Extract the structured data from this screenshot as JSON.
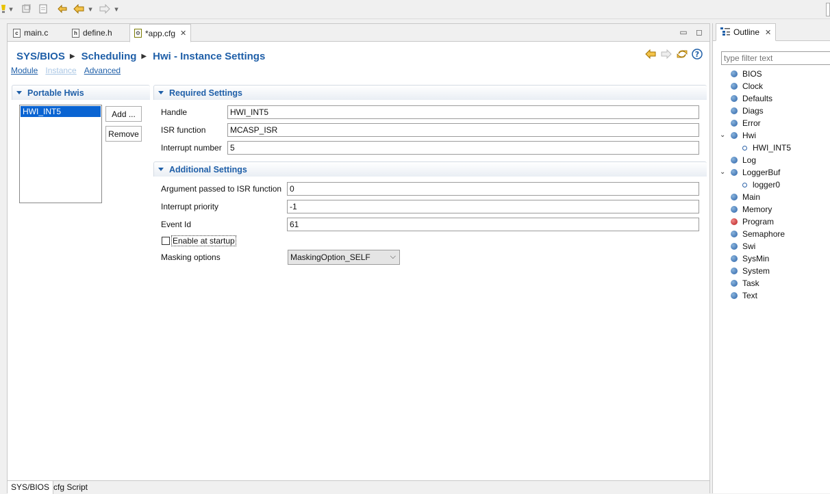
{
  "editor": {
    "tabs": [
      {
        "label": "main.c",
        "icon": "c-file-icon",
        "icon_text": "c"
      },
      {
        "label": "define.h",
        "icon": "h-file-icon",
        "icon_text": "h"
      },
      {
        "label": "*app.cfg",
        "icon": "cfg-file-icon",
        "icon_text": "⚙",
        "close": "✕"
      }
    ],
    "minimize": "▭",
    "maximize": "◻"
  },
  "breadcrumb": [
    "SYS/BIOS",
    "Scheduling",
    "Hwi - Instance Settings"
  ],
  "page_links": {
    "module": "Module",
    "instance": "Instance",
    "advanced": "Advanced"
  },
  "portable": {
    "title": "Portable Hwis",
    "items": [
      "HWI_INT5"
    ],
    "add": "Add ...",
    "remove": "Remove"
  },
  "required": {
    "title": "Required Settings",
    "handle_label": "Handle",
    "handle_value": "HWI_INT5",
    "isr_label": "ISR function",
    "isr_value": "MCASP_ISR",
    "intnum_label": "Interrupt number",
    "intnum_value": "5"
  },
  "additional": {
    "title": "Additional Settings",
    "arg_label": "Argument passed to ISR function",
    "arg_value": "0",
    "prio_label": "Interrupt priority",
    "prio_value": "-1",
    "event_label": "Event Id",
    "event_value": "61",
    "enable_label": "Enable at startup",
    "mask_label": "Masking options",
    "mask_value": "MaskingOption_SELF"
  },
  "bottom_tabs": [
    "SYS/BIOS",
    "cfg Script"
  ],
  "outline": {
    "title": "Outline",
    "close": "✕",
    "filter_placeholder": "type filter text",
    "items": [
      "BIOS",
      "Clock",
      "Defaults",
      "Diags",
      "Error",
      "Hwi",
      "HWI_INT5",
      "Log",
      "LoggerBuf",
      "logger0",
      "Main",
      "Memory",
      "Program",
      "Semaphore",
      "Swi",
      "SysMin",
      "System",
      "Task",
      "Text"
    ]
  },
  "colors": {
    "accent": "#1f5fa8",
    "selection": "#0a64d2",
    "program_dot": "#b81c1c"
  }
}
